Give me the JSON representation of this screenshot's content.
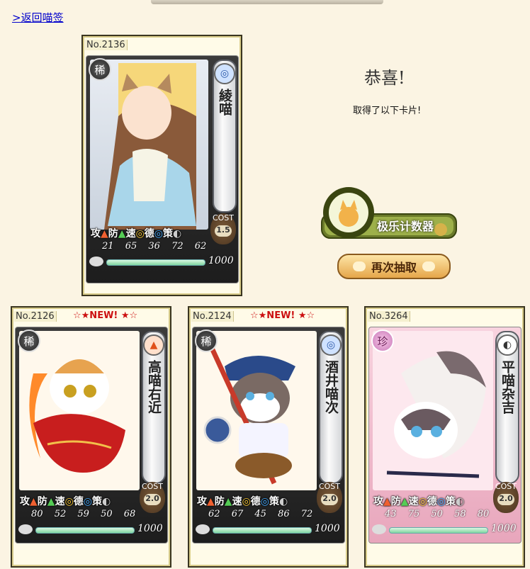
{
  "nav": {
    "back_label": ">返回喵签"
  },
  "result": {
    "congrats": "恭喜!",
    "got_text": "取得了以下卡片!",
    "counter_label": "极乐计数器",
    "redraw_label": "再次抽取"
  },
  "stat_labels": [
    "攻",
    "防",
    "速",
    "德",
    "策"
  ],
  "cost_label": "COST",
  "colors": {
    "background": "#fbf4e3",
    "redraw_button": "#e5a64a",
    "new_tag": "#cc1010"
  },
  "cards": [
    {
      "no": "No.2136",
      "new_tag": "",
      "rarity": "稀",
      "name": "綾喵",
      "stats": [
        "21",
        "65",
        "36",
        "72",
        "62"
      ],
      "cost": "1.5",
      "exp": "1000",
      "attr_icon": "water-icon"
    },
    {
      "no": "No.2126",
      "new_tag": "☆★NEW! ★☆",
      "rarity": "稀",
      "name": "高喵右近",
      "stats": [
        "80",
        "52",
        "59",
        "50",
        "68"
      ],
      "cost": "2.0",
      "exp": "1000",
      "attr_icon": "fire-icon"
    },
    {
      "no": "No.2124",
      "new_tag": "☆★NEW! ★☆",
      "rarity": "稀",
      "name": "酒井喵次",
      "stats": [
        "62",
        "67",
        "45",
        "86",
        "72"
      ],
      "cost": "2.0",
      "exp": "1000",
      "attr_icon": "water-icon"
    },
    {
      "no": "No.3264",
      "new_tag": "",
      "rarity": "珍",
      "name": "平喵杂吉",
      "stats": [
        "43",
        "75",
        "50",
        "58",
        "80"
      ],
      "cost": "2.0",
      "exp": "1000",
      "attr_icon": "moon-icon"
    }
  ]
}
